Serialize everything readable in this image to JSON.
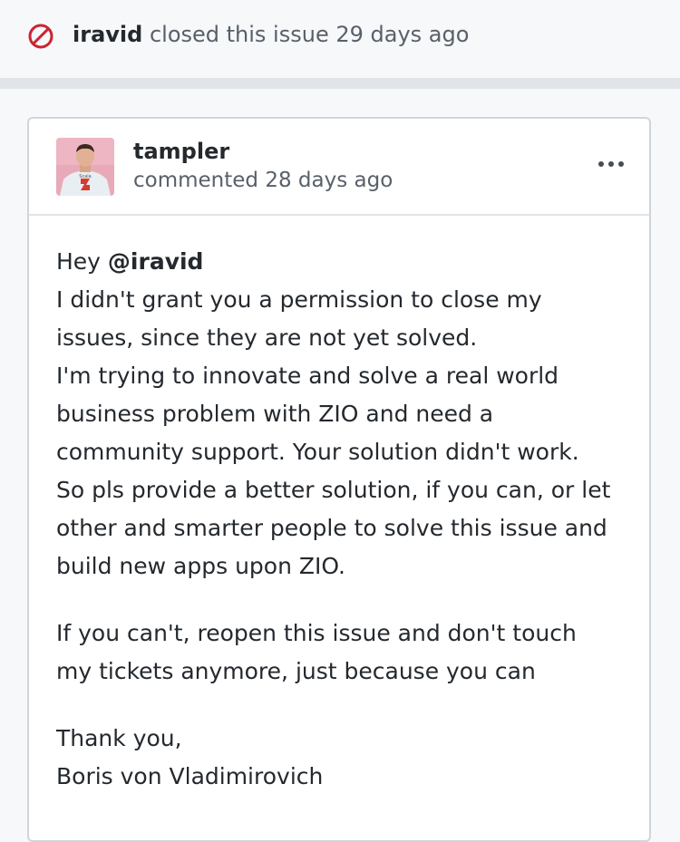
{
  "event": {
    "icon": "closed-icon",
    "icon_color": "#cb2431",
    "actor": "iravid",
    "action": "closed this issue 29 days ago"
  },
  "comment": {
    "author": "tampler",
    "timestamp": "commented 28 days ago",
    "avatar_shirt_text": "Scala",
    "menu_icon": "kebab-horizontal-icon",
    "body": {
      "greeting_prefix": "Hey ",
      "mention": "@iravid",
      "para1_lines": [
        "I didn't grant you a permission to close my",
        "issues, since they are not yet solved.",
        "I'm trying to innovate and solve a real world",
        "business problem with ZIO and need a",
        "community support. Your solution didn't work.",
        "So pls provide a better solution, if you can, or let",
        "other and smarter people to solve this issue and",
        "build new apps upon ZIO."
      ],
      "para2_lines": [
        "If you can't, reopen this issue and don't touch",
        "my tickets anymore, just because you can"
      ],
      "signoff_lines": [
        "Thank you,",
        "Boris von Vladimirovich"
      ]
    }
  }
}
